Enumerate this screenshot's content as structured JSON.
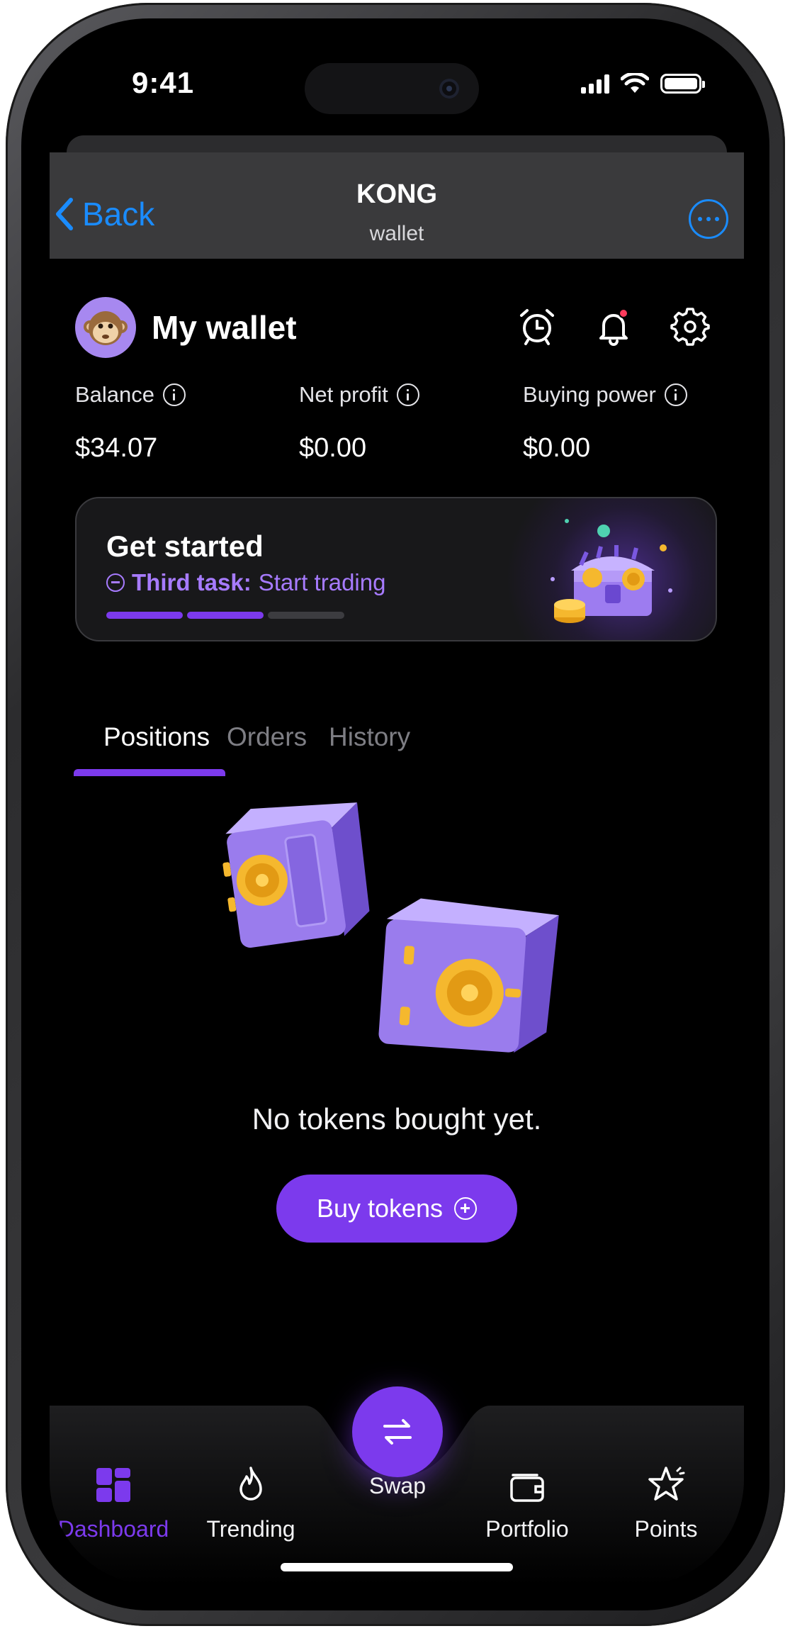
{
  "status": {
    "time": "9:41"
  },
  "nav": {
    "back_label": "Back",
    "title": "KONG",
    "subtitle": "wallet"
  },
  "wallet": {
    "title": "My wallet"
  },
  "stats": [
    {
      "label": "Balance",
      "value": "$34.07"
    },
    {
      "label": "Net profit",
      "value": "$0.00"
    },
    {
      "label": "Buying power",
      "value": "$0.00"
    }
  ],
  "get_started": {
    "title": "Get started",
    "task_prefix": "Third task:",
    "task_text": "Start trading",
    "progress": {
      "completed": 2,
      "total": 3
    }
  },
  "tabs": [
    {
      "label": "Positions",
      "active": true
    },
    {
      "label": "Orders",
      "active": false
    },
    {
      "label": "History",
      "active": false
    }
  ],
  "empty_state": {
    "message": "No tokens bought yet.",
    "button_label": "Buy tokens"
  },
  "tabbar": {
    "items": [
      {
        "label": "Dashboard",
        "icon": "dashboard-icon",
        "active": true
      },
      {
        "label": "Trending",
        "icon": "flame-icon",
        "active": false
      },
      {
        "label": "Swap",
        "icon": "swap-icon",
        "active": false
      },
      {
        "label": "Portfolio",
        "icon": "wallet-icon",
        "active": false
      },
      {
        "label": "Points",
        "icon": "star-icon",
        "active": false
      }
    ]
  },
  "colors": {
    "accent": "#7c3aed",
    "ios_blue": "#1a8cff",
    "background": "#000000",
    "nav_bar": "#3a3a3c",
    "notification_dot": "#ff3b5c"
  }
}
